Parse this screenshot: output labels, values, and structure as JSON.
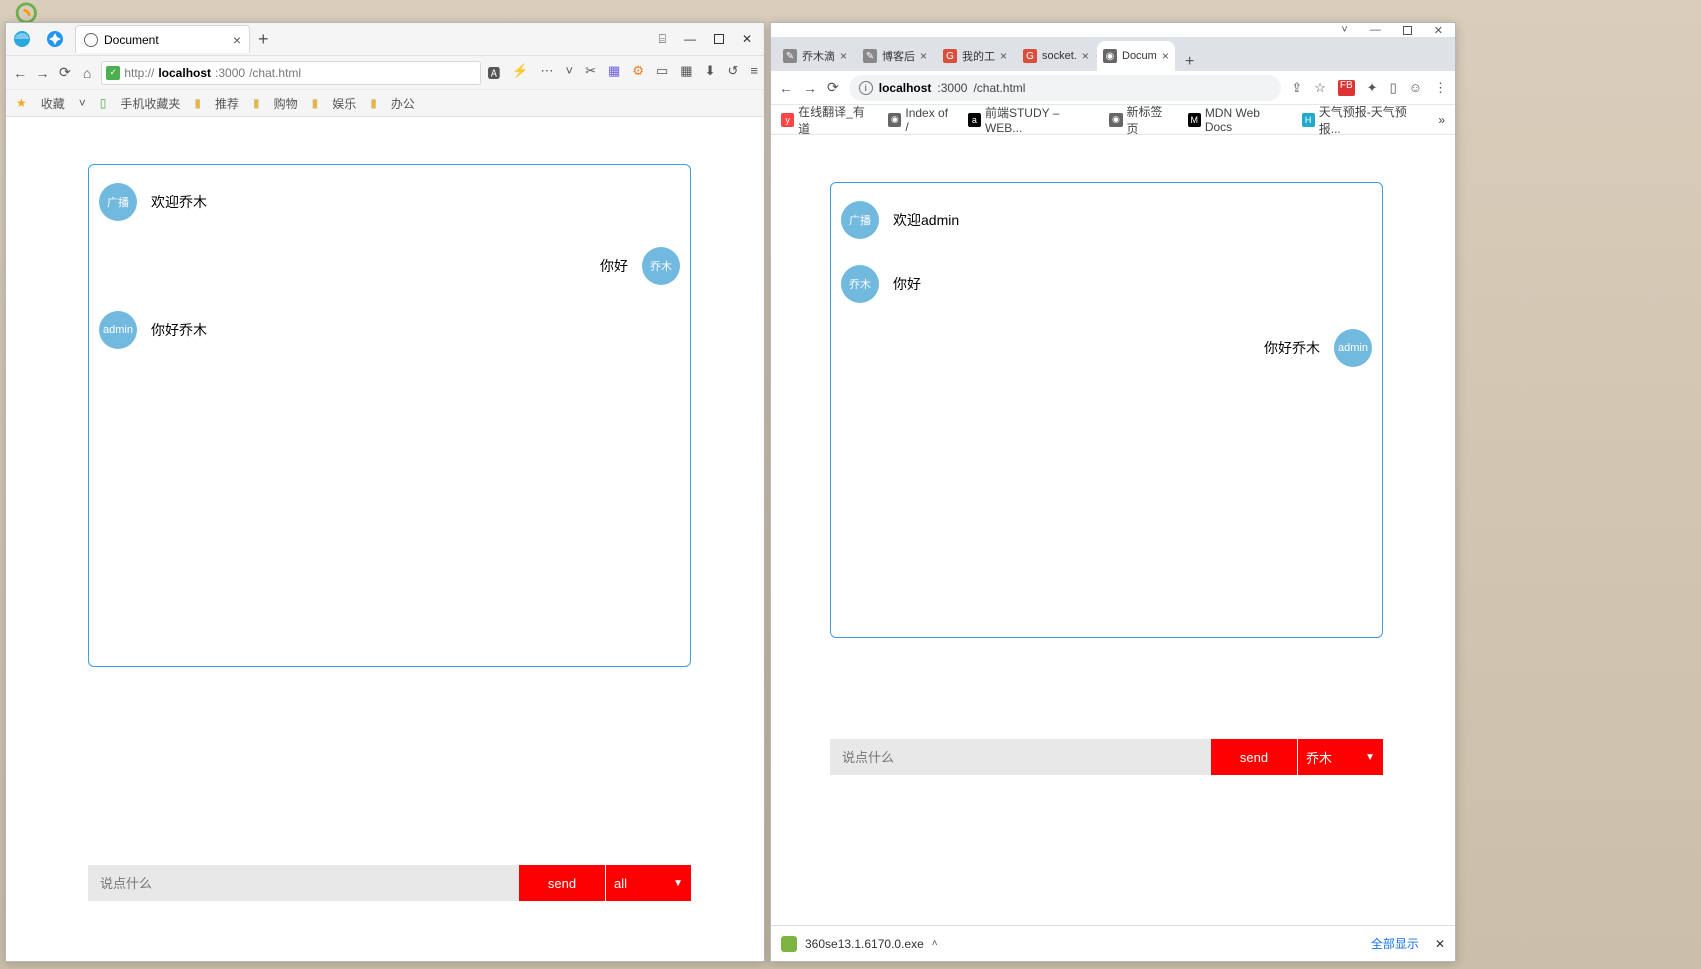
{
  "left": {
    "tab": {
      "title": "Document"
    },
    "addr": {
      "proto": "http://",
      "host": "localhost",
      "port": ":3000",
      "path": "/chat.html"
    },
    "bookmarks": {
      "fav_label": "收藏",
      "items": [
        "手机收藏夹",
        "推荐",
        "购物",
        "娱乐",
        "办公"
      ]
    },
    "chat": {
      "messages": [
        {
          "side": "left",
          "avatar": "广播",
          "text": "欢迎乔木"
        },
        {
          "side": "right",
          "avatar": "乔木",
          "text": "你好"
        },
        {
          "side": "left",
          "avatar": "admin",
          "text": "你好乔木"
        }
      ],
      "input_placeholder": "说点什么",
      "send_label": "send",
      "select_label": "all"
    }
  },
  "right": {
    "tabs": [
      {
        "title": "乔木滴",
        "favicon_bg": "#888",
        "favicon_text": "✎"
      },
      {
        "title": "博客后",
        "favicon_bg": "#888",
        "favicon_text": "✎"
      },
      {
        "title": "我的工",
        "favicon_bg": "#d94f3a",
        "favicon_text": "G"
      },
      {
        "title": "socket.",
        "favicon_bg": "#d94f3a",
        "favicon_text": "G"
      },
      {
        "title": "Docum",
        "favicon_bg": "#666",
        "favicon_text": "◉",
        "active": true
      }
    ],
    "addr": {
      "host": "localhost",
      "port": ":3000",
      "path": "/chat.html"
    },
    "bookmarks": [
      {
        "icon": "y",
        "icon_bg": "#f44",
        "label": "在线翻译_有道"
      },
      {
        "icon": "◉",
        "icon_bg": "#666",
        "label": "Index of /"
      },
      {
        "icon": "a",
        "icon_bg": "#000",
        "label": "前端STUDY – WEB..."
      },
      {
        "icon": "◉",
        "icon_bg": "#666",
        "label": "新标签页"
      },
      {
        "icon": "M",
        "icon_bg": "#000",
        "label": "MDN Web Docs"
      },
      {
        "icon": "H",
        "icon_bg": "#2ac",
        "label": "天气预报-天气预报..."
      }
    ],
    "chat": {
      "messages": [
        {
          "side": "left",
          "avatar": "广播",
          "text": "欢迎admin"
        },
        {
          "side": "left",
          "avatar": "乔木",
          "text": "你好"
        },
        {
          "side": "right",
          "avatar": "admin",
          "text": "你好乔木"
        }
      ],
      "input_placeholder": "说点什么",
      "send_label": "send",
      "select_label": "乔木"
    },
    "download": {
      "filename": "360se13.1.6170.0.exe",
      "show_all": "全部显示"
    }
  }
}
